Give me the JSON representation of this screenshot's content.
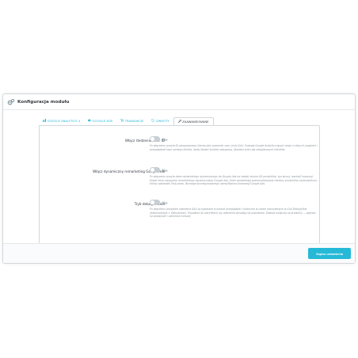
{
  "panel": {
    "title": "Konfiguracja modułu",
    "icon": "gears-icon"
  },
  "tabs": [
    {
      "label": "GOOGLE ANALYTICS 4",
      "icon": "chart-icon",
      "active": false
    },
    {
      "label": "GOOGLE ADS",
      "icon": "bullhorn-icon",
      "active": false
    },
    {
      "label": "TRANSAKCJE",
      "icon": "cart-icon",
      "active": false
    },
    {
      "label": "ZWROTY",
      "icon": "undo-icon",
      "active": false
    },
    {
      "label": "ZAAWANSOWANE",
      "icon": "wrench-icon",
      "active": true
    }
  ],
  "settings": [
    {
      "label": "Włącz śledzenie User ID",
      "toggle_text": "Nie",
      "help": "Po włączeniu wysyła ID zalogowanego klienta jako parametr user_id do GA4. Pozwala Google Analytics łączyć sesje z różnych urządzeń i przeglądarek tego samego klienta, lepiej śledzić ścieżkę zakupową. Aktywne tylko dla zalogowanych klientów."
    },
    {
      "label": "Włącz dynamiczny remarketing Google Ads",
      "toggle_text": "Nie",
      "help": "Po włączeniu wysyła dane remarketingu dynamicznego do Google Ads na każdej stronie (ID produktów, typ strony, wartość koszyka). Dzięki temu kampanie remarketingu dynamicznego Google Ads, które wyświetlają spersonalizowane reklamy produktów użytkownikom, którzy odwiedzili Twój sklep. Wymaga skonfigurowanego identyfikatora konwersji Google Ads."
    },
    {
      "label": "Tryb debugowania",
      "toggle_text": "Nie",
      "help": "Po włączeniu wszystkie zdarzenia GA4 są logowane w konsoli przeglądarki i widoczne w czasie rzeczywistym w GA4 DebugView (Administracja > DebugView). Przydatne do weryfikacji czy zdarzenia wysyłają się poprawnie. Zawsze wyłączaj na produkcji — wpływa na wydajność i zaśmieca konsolę."
    }
  ],
  "footer": {
    "save_label": "Zapisz ustawienia"
  },
  "colors": {
    "accent": "#25b9d7",
    "toggle_off": "#c9cfd3"
  }
}
